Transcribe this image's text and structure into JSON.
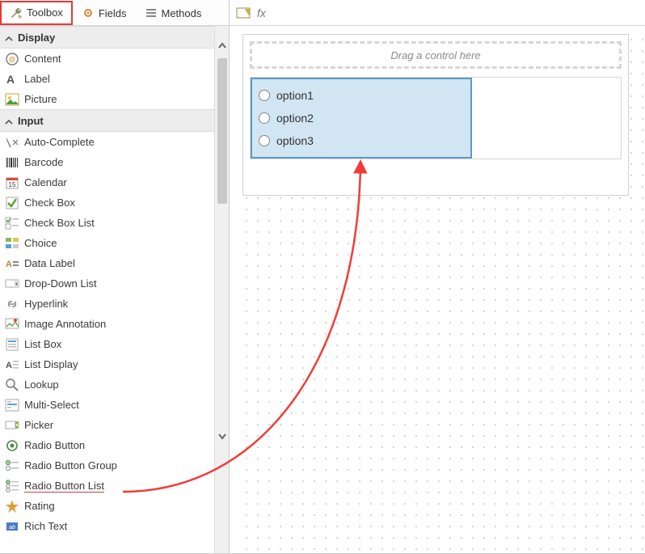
{
  "tabs": {
    "toolbox": "Toolbox",
    "fields": "Fields",
    "methods": "Methods"
  },
  "sections": {
    "display": "Display",
    "input": "Input"
  },
  "display_items": [
    {
      "label": "Content",
      "icon": "content-icon"
    },
    {
      "label": "Label",
      "icon": "label-icon"
    },
    {
      "label": "Picture",
      "icon": "picture-icon"
    }
  ],
  "input_items": [
    {
      "label": "Auto-Complete",
      "icon": "autocomplete-icon"
    },
    {
      "label": "Barcode",
      "icon": "barcode-icon"
    },
    {
      "label": "Calendar",
      "icon": "calendar-icon"
    },
    {
      "label": "Check Box",
      "icon": "checkbox-icon"
    },
    {
      "label": "Check Box List",
      "icon": "checkboxlist-icon"
    },
    {
      "label": "Choice",
      "icon": "choice-icon"
    },
    {
      "label": "Data Label",
      "icon": "datalabel-icon"
    },
    {
      "label": "Drop-Down List",
      "icon": "dropdown-icon"
    },
    {
      "label": "Hyperlink",
      "icon": "hyperlink-icon"
    },
    {
      "label": "Image Annotation",
      "icon": "imageannot-icon"
    },
    {
      "label": "List Box",
      "icon": "listbox-icon"
    },
    {
      "label": "List Display",
      "icon": "listdisplay-icon"
    },
    {
      "label": "Lookup",
      "icon": "lookup-icon"
    },
    {
      "label": "Multi-Select",
      "icon": "multiselect-icon"
    },
    {
      "label": "Picker",
      "icon": "picker-icon"
    },
    {
      "label": "Radio Button",
      "icon": "radio-icon"
    },
    {
      "label": "Radio Button Group",
      "icon": "radiogroup-icon"
    },
    {
      "label": "Radio Button List",
      "icon": "radiolist-icon",
      "selected": true
    },
    {
      "label": "Rating",
      "icon": "rating-icon"
    },
    {
      "label": "Rich Text",
      "icon": "richtext-icon"
    }
  ],
  "canvas": {
    "drop_hint": "Drag a control here",
    "radio_options": [
      "option1",
      "option2",
      "option3"
    ]
  }
}
